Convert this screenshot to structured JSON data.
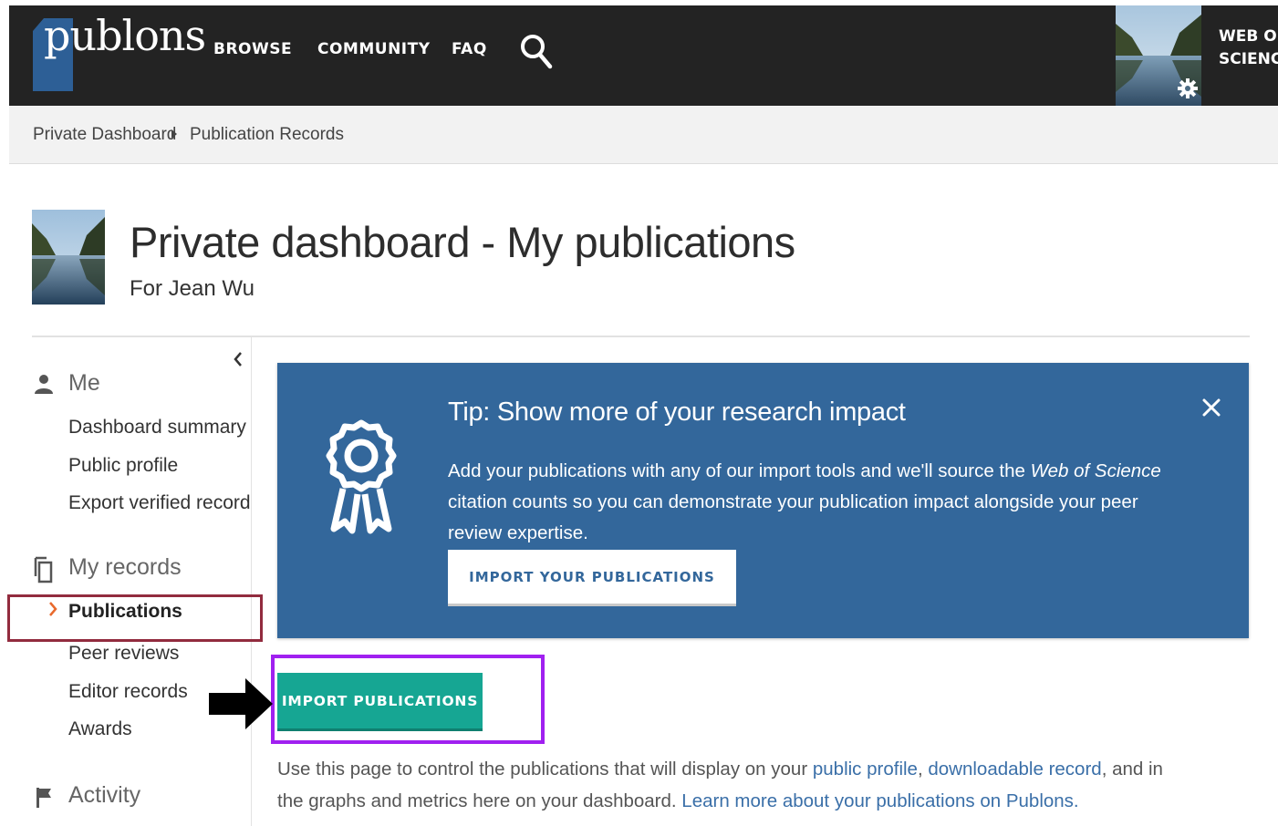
{
  "nav": {
    "logo_text": "publons",
    "links": [
      "BROWSE",
      "COMMUNITY",
      "FAQ"
    ],
    "wos_line1": "WEB OF",
    "wos_line2": "SCIENC"
  },
  "breadcrumb": {
    "items": [
      "Private Dashboard",
      "Publication Records"
    ]
  },
  "header": {
    "title": "Private dashboard - My publications",
    "subtitle": "For Jean Wu"
  },
  "sidebar": {
    "me_label": "Me",
    "me_items": [
      "Dashboard summary",
      "Public profile",
      "Export verified record"
    ],
    "records_label": "My records",
    "records_items": [
      "Publications",
      "Peer reviews",
      "Editor records",
      "Awards"
    ],
    "activity_label": "Activity"
  },
  "tip": {
    "title": "Tip: Show more of your research impact",
    "body_part1": "Add your publications with any of our import tools and we'll source the ",
    "body_italic": "Web of Science",
    "body_part2": " citation counts so you can demonstrate your publication impact alongside your peer review expertise.",
    "button_label": "IMPORT YOUR PUBLICATIONS"
  },
  "import_button_label": "IMPORT PUBLICATIONS",
  "description": {
    "text1": "Use this page to control the publications that will display on your ",
    "link1": "public profile",
    "text2": ", ",
    "link2": "downloadable record",
    "text3": ", and in the graphs and metrics here on your dashboard. ",
    "link3": "Learn more about your publications on Publons."
  },
  "colors": {
    "nav_bg": "#232323",
    "tip_bg": "#33679b",
    "import_button": "#16a693",
    "highlight_red": "#922b3e",
    "highlight_purple": "#a020f0",
    "active_chevron": "#e8692c",
    "link": "#3a6fa8"
  }
}
